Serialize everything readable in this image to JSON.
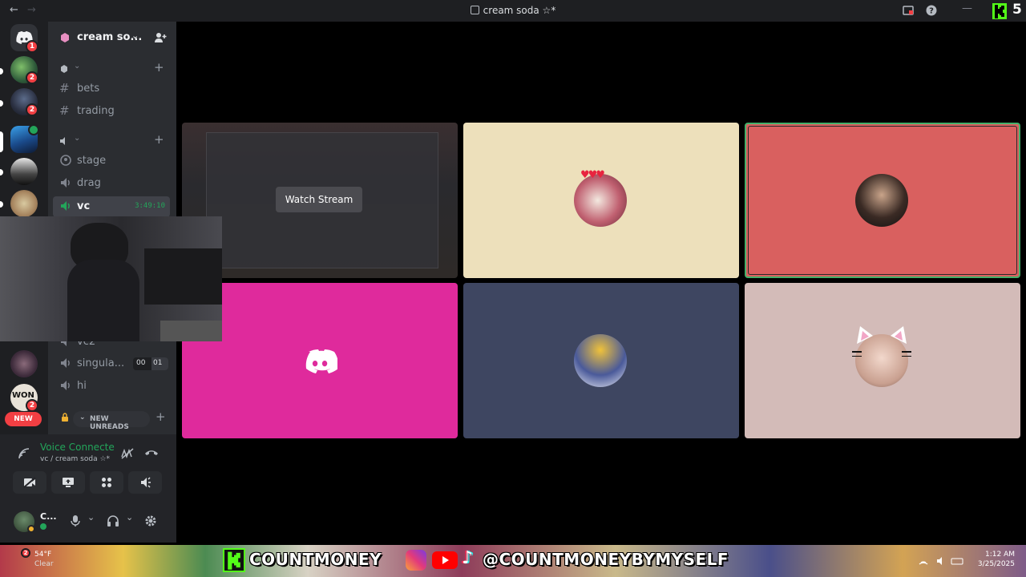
{
  "window": {
    "title": "cream soda ☆*",
    "back": "←",
    "forward": "→",
    "minimize": "—",
    "overlay_number": "5"
  },
  "rail": {
    "home_badge": "1",
    "server_badges": [
      "2",
      "2",
      "2"
    ],
    "new_label": "NEW"
  },
  "channels": {
    "server_name": "cream so...",
    "text": [
      {
        "label": "bets"
      },
      {
        "label": "trading"
      }
    ],
    "voice": [
      {
        "label": "stage"
      },
      {
        "label": "drag"
      },
      {
        "label": "vc",
        "timer": "3:49:10"
      }
    ],
    "lower_voice": [
      {
        "label": "vc2"
      },
      {
        "label": "singula...",
        "count_left": "00",
        "count_right": "01"
      },
      {
        "label": "hi"
      }
    ],
    "new_unreads": "NEW UNREADS"
  },
  "voice_panel": {
    "title": "Voice Connecte",
    "subtitle": "vc / cream soda ☆*",
    "user_initial": "C..."
  },
  "stage": {
    "watch_stream": "Watch Stream",
    "tiles": [
      {
        "bg": "#2b2b2e",
        "kind": "stream"
      },
      {
        "bg": "#ede0bb",
        "kind": "avatar"
      },
      {
        "bg": "#d9605f",
        "kind": "avatar",
        "speaking": true
      },
      {
        "bg": "#df2a9c",
        "kind": "discord-logo"
      },
      {
        "bg": "#3e4661",
        "kind": "avatar"
      },
      {
        "bg": "#d3bbb8",
        "kind": "avatar"
      }
    ]
  },
  "banner": {
    "kick_name": "COUNTMONEY",
    "social_handle": "@COUNTMONEYBYMYSELF",
    "weather_temp": "54°F",
    "weather_cond": "Clear",
    "weather_badge": "2",
    "time": "1:12 AM",
    "date": "3/25/2025"
  },
  "colors": {
    "accent_green": "#23a55a",
    "kick_green": "#53fc18",
    "alert_red": "#f23f43"
  }
}
